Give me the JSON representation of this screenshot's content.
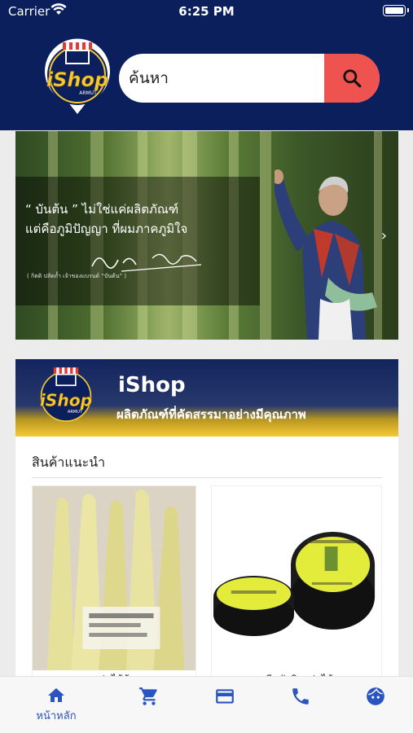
{
  "status_bar": {
    "carrier": "Carrier",
    "time": "6:25 PM"
  },
  "header": {
    "logo_text": "iShop",
    "logo_subtext": "ARMUT",
    "search": {
      "placeholder": "ค้นหา"
    }
  },
  "banner1": {
    "quote_line1": "“ บันต้น ” ไม่ใช่แค่ผลิตภัณฑ์",
    "quote_line2": "แต่คือภูมิปัญญา ที่ผมภาคภูมิใจ",
    "credit": "( กิตติ ปลัดถ้ำ เจ้าของแบรนด์ “บันต้น” )"
  },
  "banner2": {
    "logo_text": "iShop",
    "logo_subtext": "ARMUT",
    "title": "iShop",
    "subtitle": "ผลิตภัณฑ์ที่คัดสรรมาอย่างมีคุณภาพ"
  },
  "recommended": {
    "title": "สินค้าแนะนำ",
    "products": [
      {
        "name": "หน่อไม้ต้ม"
      },
      {
        "name": "ครีมขัดผิวหน่อไม้"
      }
    ]
  },
  "colors": {
    "header_bg": "#0b1f5c",
    "search_button": "#ef5350",
    "nav_active": "#2a54c0",
    "logo_yellow": "#f6c934"
  },
  "bottom_nav": {
    "items": [
      {
        "icon": "home-icon",
        "label": "หน้าหลัก"
      },
      {
        "icon": "cart-icon",
        "label": ""
      },
      {
        "icon": "credit-card-icon",
        "label": ""
      },
      {
        "icon": "phone-icon",
        "label": ""
      },
      {
        "icon": "face-icon",
        "label": ""
      }
    ]
  }
}
